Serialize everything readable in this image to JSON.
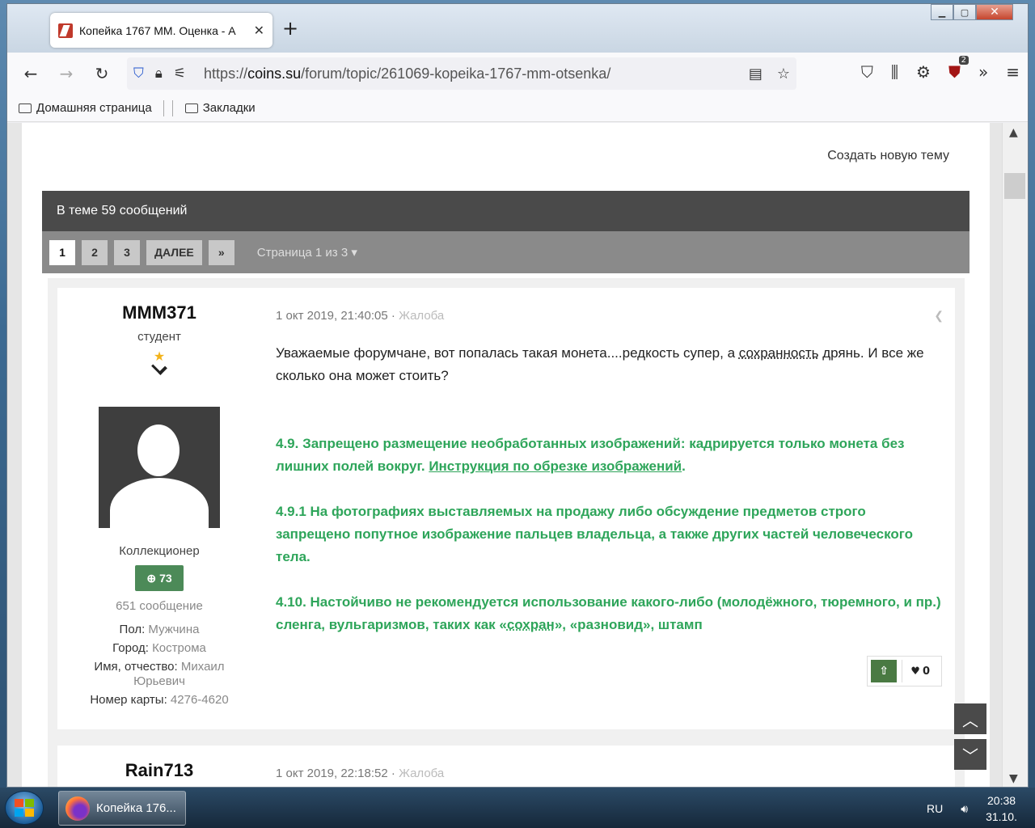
{
  "browser": {
    "tab_title": "Копейка 1767 ММ. Оценка - А",
    "url_host": "coins.su",
    "url_prefix": "https://",
    "url_path": "/forum/topic/261069-kopeika-1767-mm-otsenka/",
    "ublock_count": "2",
    "bookmarks": [
      "Домашняя страница",
      "Закладки"
    ]
  },
  "forum": {
    "new_topic": "Создать новую тему",
    "topic_count": "В теме 59 сообщений",
    "pages": [
      "1",
      "2",
      "3"
    ],
    "next_label": "ДАЛЕЕ",
    "last_label": "»",
    "page_info": "Страница 1 из 3"
  },
  "post1": {
    "author": "MMM371",
    "rank": "студент",
    "group": "Коллекционер",
    "reputation": "73",
    "posts": "651 сообщение",
    "fields": [
      {
        "label": "Пол:",
        "value": "Мужчина"
      },
      {
        "label": "Город:",
        "value": "Кострома"
      },
      {
        "label": "Имя, отчество:",
        "value": "Михаил Юрьевич"
      },
      {
        "label": "Номер карты:",
        "value": "4276-4620"
      }
    ],
    "date": "1 окт 2019, 21:40:05",
    "report": "Жалоба",
    "text_a": "Уважаемые форумчане, вот попалась такая монета....редкость супер, а ",
    "text_link": "сохранность",
    "text_b": " дрянь. И все же сколько она может стоить?",
    "rule1_a": "4.9. Запрещено размещение необработанных изображений: кадрируется только монета без лишних полей вокруг. ",
    "rule1_link": "Инструкция по обрезке изображений",
    "rule1_b": ".",
    "rule2": "4.9.1 На фотографиях выставляемых на продажу либо обсуждение предметов строго запрещено попутное изображение пальцев владельца, а также других частей человеческого тела.",
    "rule3_a": "4.10. Настойчиво не рекомендуется использование какого-либо (молодёжного, тюремного, и пр.) сленга, вульгаризмов, таких как «",
    "rule3_link": "сохран",
    "rule3_b": "», «разновид», штамп",
    "likes": "0"
  },
  "post2": {
    "author": "Rain713",
    "date": "1 окт 2019, 22:18:52",
    "report": "Жалоба"
  },
  "taskbar": {
    "app_label": "Копейка 176...",
    "lang": "RU",
    "time": "20:38",
    "date": "31.10."
  }
}
